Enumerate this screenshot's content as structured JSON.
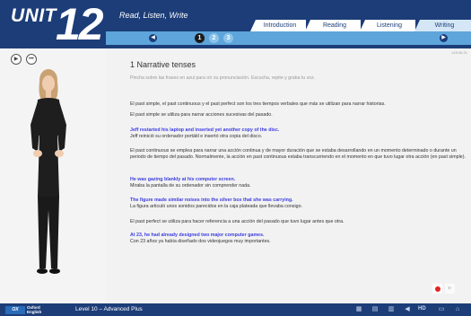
{
  "header": {
    "unit_word": "UNIT",
    "unit_number": "12",
    "section_title": "Read, Listen, Write",
    "tabs": [
      {
        "label": "Introduction"
      },
      {
        "label": "Reading"
      },
      {
        "label": "Listening"
      },
      {
        "label": "Writing",
        "active": true
      }
    ],
    "pages": [
      "1",
      "2",
      "3"
    ],
    "current_page": "1"
  },
  "content": {
    "version": "v15.06.21",
    "title": "1  Narrative tenses",
    "instruction": "Pincha sobre las frases en azul para oír su pronunciación. Escucha, repite y graba tu voz.",
    "paragraphs": [
      {
        "type": "es",
        "text": "El past simple, el past continuous y el past perfect son los tres tiempos verbales que más se utilizan para narrar historias."
      },
      {
        "type": "es",
        "text": "El past simple se utiliza para narrar acciones sucesivas del pasado."
      },
      {
        "type": "en",
        "text": "Jeff restarted his laptop and inserted yet another copy of the disc."
      },
      {
        "type": "es",
        "text": "Jeff reinició su ordenador portátil e insertó otra copia del disco."
      },
      {
        "type": "es",
        "text": "El past continuous se emplea para narrar una acción continua y de mayor duración que se estaba desarrollando en un momento determinado o durante un periodo de tiempo del pasado. Normalmente, la acción en past continuous estaba transcurriendo en el momento en que tuvo lugar otra acción (en past simple)."
      },
      {
        "type": "en",
        "text": "He was gazing blankly at his computer screen."
      },
      {
        "type": "es",
        "text": "Miraba la pantalla de su ordenador sin comprender nada."
      },
      {
        "type": "en",
        "text": "The figure made similar noises into the silver box that she was carrying."
      },
      {
        "type": "es",
        "text": "La figura articuló unos sonidos parecidos en la caja plateada que llevaba consigo."
      },
      {
        "type": "es",
        "text": "El past perfect se utiliza para hacer referencia a una acción del pasado que tuvo lugar antes que otra."
      },
      {
        "type": "en",
        "text": "At 23, he had already designed two major computer games."
      },
      {
        "type": "es",
        "text": "Con 23 años ya había diseñado dos videojuegos muy importantes."
      }
    ]
  },
  "footer": {
    "logo_mark": "OX",
    "logo_text_1": "Oxford",
    "logo_text_2": "English",
    "level": "Level 10 – Advanced Plus",
    "hd_label": "HD"
  },
  "colors": {
    "header_blue": "#1c3d78",
    "nav_blue": "#5ea5db",
    "english_text": "#3e3ee0",
    "record_red": "#e02424"
  },
  "icons": [
    "play-icon",
    "skip-back-icon",
    "prev-arrow-icon",
    "next-arrow-icon",
    "record-icon",
    "play-recording-icon",
    "grid-icon",
    "book-icon",
    "notes-icon",
    "volume-icon",
    "hd-icon",
    "comment-icon",
    "home-icon"
  ]
}
